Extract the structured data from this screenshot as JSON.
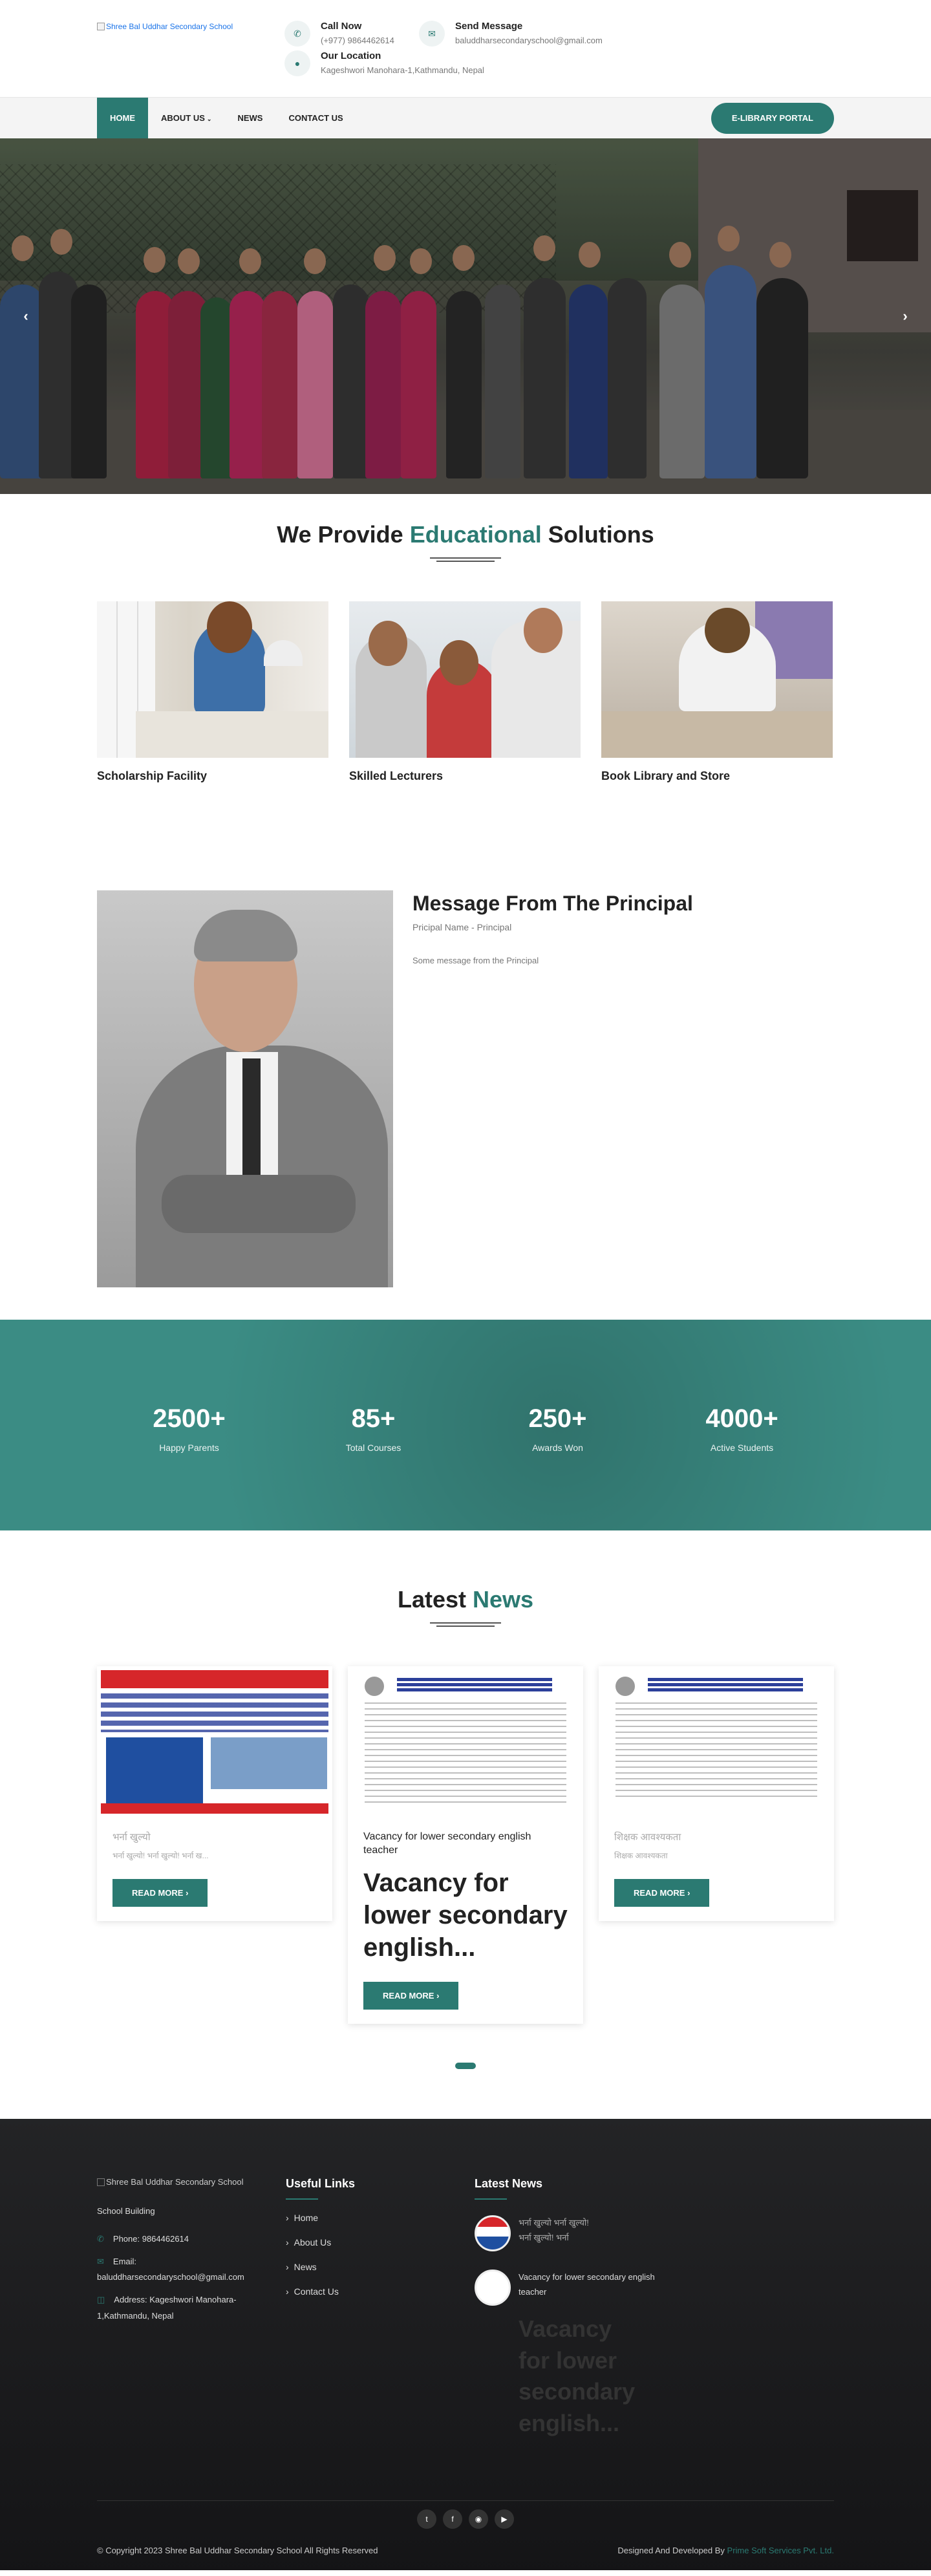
{
  "header": {
    "logo_alt": "Shree Bal Uddhar Secondary School",
    "call": {
      "title": "Call Now",
      "value": "(+977) 9864462614"
    },
    "message": {
      "title": "Send Message",
      "value": "baluddharsecondaryschool@gmail.com"
    },
    "location": {
      "title": "Our Location",
      "value": "Kageshwori Manohara-1,Kathmandu, Nepal"
    }
  },
  "nav": {
    "items": [
      {
        "label": "HOME",
        "active": true
      },
      {
        "label": "ABOUT US",
        "dropdown": true
      },
      {
        "label": "NEWS"
      },
      {
        "label": "CONTACT US"
      }
    ],
    "cta": "E-LIBRARY PORTAL"
  },
  "hero": {
    "prev_icon": "chevron-left-icon",
    "next_icon": "chevron-right-icon"
  },
  "features": {
    "title_pre": "We Provide ",
    "title_hl": "Educational",
    "title_post": " Solutions",
    "cards": [
      {
        "title": "Scholarship Facility"
      },
      {
        "title": "Skilled Lecturers"
      },
      {
        "title": "Book Library and Store"
      }
    ]
  },
  "principal": {
    "heading": "Message From The Principal",
    "name": "Pricipal Name - Principal",
    "message": "Some message from the Principal"
  },
  "stats": [
    {
      "value": "2500+",
      "label": "Happy Parents"
    },
    {
      "value": "85+",
      "label": "Total Courses"
    },
    {
      "value": "250+",
      "label": "Awards Won"
    },
    {
      "value": "4000+",
      "label": "Active Students"
    }
  ],
  "news": {
    "title_pre": "Latest ",
    "title_hl": "News",
    "read_more": "READ MORE",
    "cards": [
      {
        "title": "भर्ना खुल्यो",
        "excerpt": "भर्ना खुल्यो! भर्ना खुल्यो! भर्ना ख..."
      },
      {
        "title": "Vacancy for lower secondary english teacher",
        "excerpt": "Vacancy for lower secondary english..."
      },
      {
        "title": "शिक्षक आवश्यकता",
        "excerpt": "शिक्षक आवश्यकता"
      }
    ]
  },
  "footer": {
    "logo_alt": "Shree Bal Uddhar Secondary School",
    "caption": "School Building",
    "phone": "Phone: 9864462614",
    "email_label": "Email:",
    "email": "baluddharsecondaryschool@gmail.com",
    "address": "Address: Kageshwori Manohara-1,Kathmandu, Nepal",
    "useful_links_title": "Useful Links",
    "links": [
      "Home",
      "About Us",
      "News",
      "Contact Us"
    ],
    "latest_news_title": "Latest News",
    "news": [
      {
        "text": "भर्ना खुल्यो भर्ना खुल्यो! भर्ना खुल्यो! भर्ना"
      },
      {
        "text": "Vacancy for lower secondary english teacher"
      }
    ],
    "news_big": "Vacancy for lower secondary english...",
    "copyright": "© Copyright 2023 Shree Bal Uddhar Secondary School All Rights Reserved",
    "dev_pre": "Designed And Developed By ",
    "dev_link": "Prime Soft Services Pvt. Ltd."
  }
}
